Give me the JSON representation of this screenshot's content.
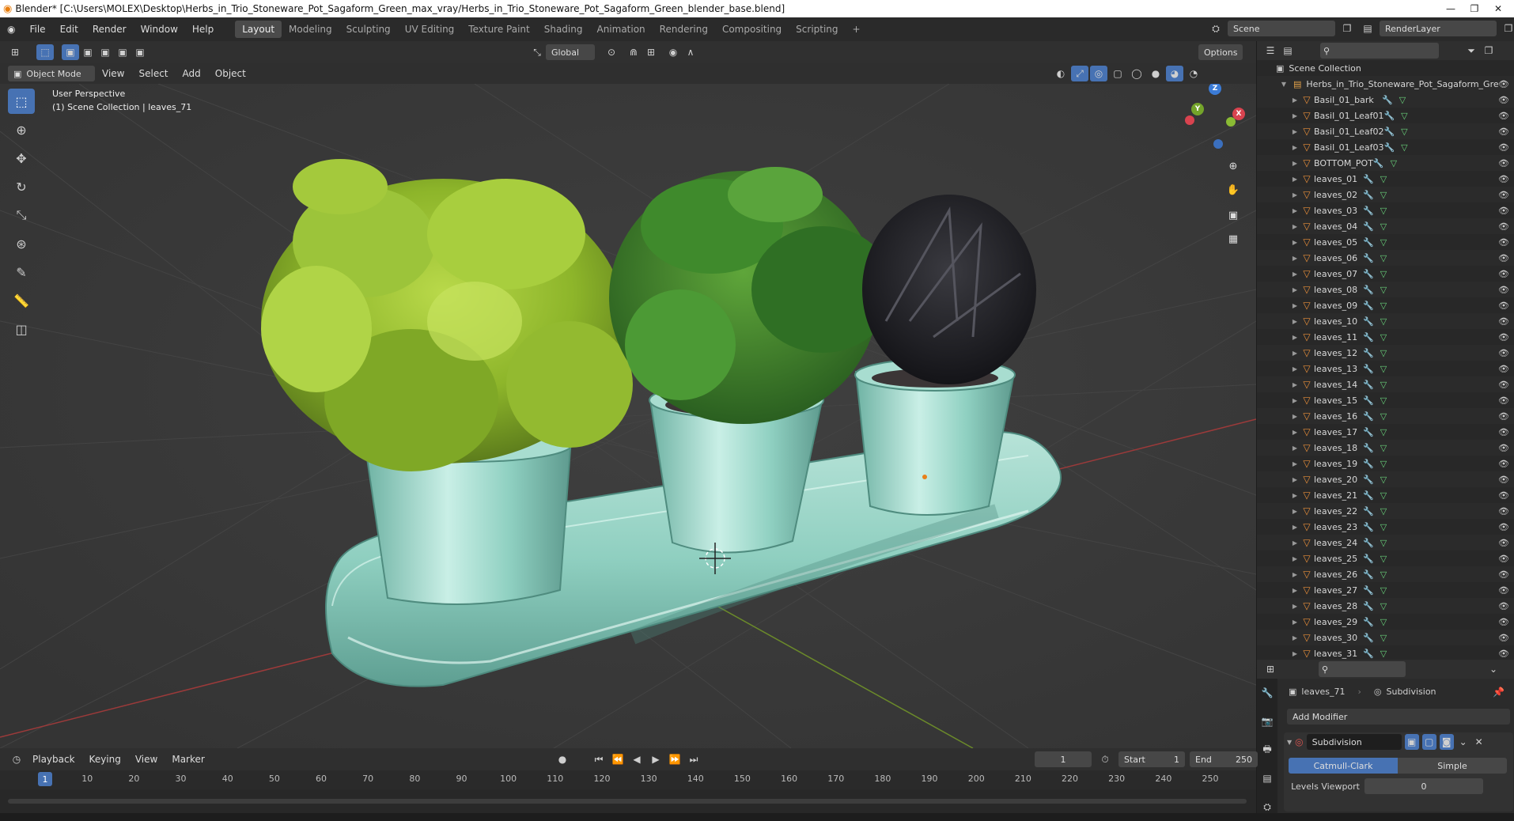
{
  "window": {
    "title": "Blender* [C:\\Users\\MOLEX\\Desktop\\Herbs_in_Trio_Stoneware_Pot_Sagaform_Green_max_vray/Herbs_in_Trio_Stoneware_Pot_Sagaform_Green_blender_base.blend]",
    "minimize": "—",
    "maximize": "❐",
    "close": "✕"
  },
  "menu": [
    "File",
    "Edit",
    "Render",
    "Window",
    "Help"
  ],
  "workspaces": [
    "Layout",
    "Modeling",
    "Sculpting",
    "UV Editing",
    "Texture Paint",
    "Shading",
    "Animation",
    "Rendering",
    "Compositing",
    "Scripting"
  ],
  "add_workspace": "+",
  "scene": {
    "label": "Scene",
    "render_layer": "RenderLayer"
  },
  "viewport_header": {
    "transform": "Global",
    "options": "Options",
    "mode": "Object Mode",
    "menus": [
      "View",
      "Select",
      "Add",
      "Object"
    ]
  },
  "viewport": {
    "perspective": "User Perspective",
    "collection_info": "(1) Scene Collection | leaves_71"
  },
  "gizmo": {
    "x": "X",
    "y": "Y",
    "z": "Z"
  },
  "outliner": {
    "scene_collection": "Scene Collection",
    "collection": "Herbs_in_Trio_Stoneware_Pot_Sagaform_Gre",
    "objects": [
      "Basil_01_bark",
      "Basil_01_Leaf01",
      "Basil_01_Leaf02",
      "Basil_01_Leaf03",
      "BOTTOM_POT",
      "leaves_01",
      "leaves_02",
      "leaves_03",
      "leaves_04",
      "leaves_05",
      "leaves_06",
      "leaves_07",
      "leaves_08",
      "leaves_09",
      "leaves_10",
      "leaves_11",
      "leaves_12",
      "leaves_13",
      "leaves_14",
      "leaves_15",
      "leaves_16",
      "leaves_17",
      "leaves_18",
      "leaves_19",
      "leaves_20",
      "leaves_21",
      "leaves_22",
      "leaves_23",
      "leaves_24",
      "leaves_25",
      "leaves_26",
      "leaves_27",
      "leaves_28",
      "leaves_29",
      "leaves_30",
      "leaves_31"
    ]
  },
  "properties": {
    "object": "leaves_71",
    "modifier_crumb": "Subdivision",
    "add_modifier": "Add Modifier",
    "modifier_name": "Subdivision",
    "catmull": "Catmull-Clark",
    "simple": "Simple",
    "levels_label": "Levels Viewport",
    "levels_value": "0"
  },
  "timeline": {
    "menus": [
      "Playback",
      "Keying",
      "View",
      "Marker"
    ],
    "current_frame": "1",
    "start_label": "Start",
    "start": "1",
    "end_label": "End",
    "end": "250",
    "ticks": [
      "1",
      "10",
      "20",
      "30",
      "40",
      "50",
      "60",
      "70",
      "80",
      "90",
      "100",
      "110",
      "120",
      "130",
      "140",
      "150",
      "160",
      "170",
      "180",
      "190",
      "200",
      "210",
      "220",
      "230",
      "240",
      "250"
    ]
  }
}
